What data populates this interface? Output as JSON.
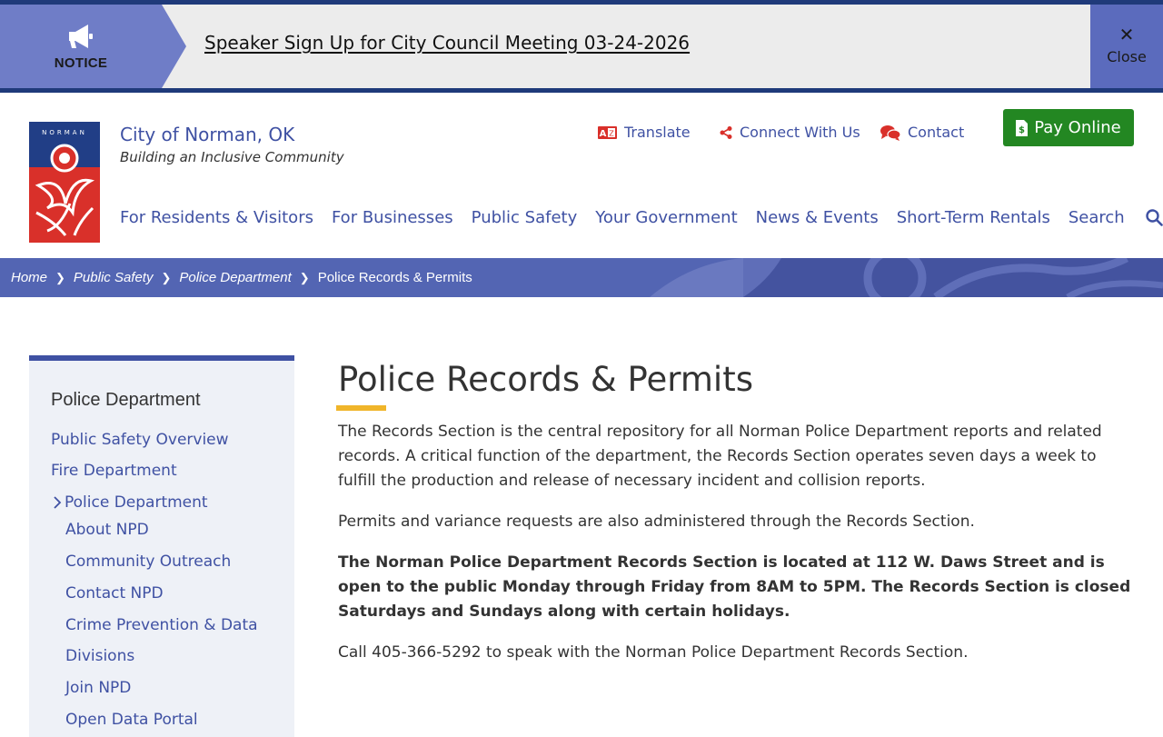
{
  "notice": {
    "label": "NOTICE",
    "message": "Speaker Sign Up for City Council Meeting 03-24-2026",
    "close": "Close"
  },
  "site": {
    "name": "City of Norman, OK",
    "tagline": "Building an Inclusive Community",
    "logo_text": "NORMAN"
  },
  "utility": {
    "translate": "Translate",
    "connect": "Connect With Us",
    "contact": "Contact",
    "pay": "Pay Online"
  },
  "nav": [
    "For Residents & Visitors",
    "For Businesses",
    "Public Safety",
    "Your Government",
    "News & Events",
    "Short-Term Rentals"
  ],
  "search_label": "Search",
  "breadcrumb": [
    "Home",
    "Public Safety",
    "Police Department",
    "Police Records & Permits"
  ],
  "sidebar": {
    "title": "Police Department",
    "top_links": [
      "Public Safety Overview",
      "Fire Department"
    ],
    "current": "Police Department",
    "sub_links": [
      "About NPD",
      "Community Outreach",
      "Contact NPD",
      "Crime Prevention & Data",
      "Divisions",
      "Join NPD",
      "Open Data Portal"
    ]
  },
  "main": {
    "title": "Police Records & Permits",
    "paragraphs": [
      "The Records Section is the central repository for all Norman Police Department reports and related records. A critical function of the department, the Records Section operates seven days a week to fulfill the production and release of necessary incident and collision reports.",
      "Permits and variance requests are also administered through the Records Section.",
      "The Norman Police Department Records Section is located at 112 W. Daws Street and is open to the public Monday through Friday from 8AM to 5PM. The Records Section is closed Saturdays and Sundays along with certain holidays.",
      "Call 405-366-5292 to speak with the Norman Police Department Records Section."
    ]
  },
  "colors": {
    "brand_blue": "#3f51a3",
    "notice_purple": "#6f7dc7",
    "pay_green": "#238722",
    "accent_gold": "#f0b52a",
    "logo_red": "#d9302a"
  }
}
